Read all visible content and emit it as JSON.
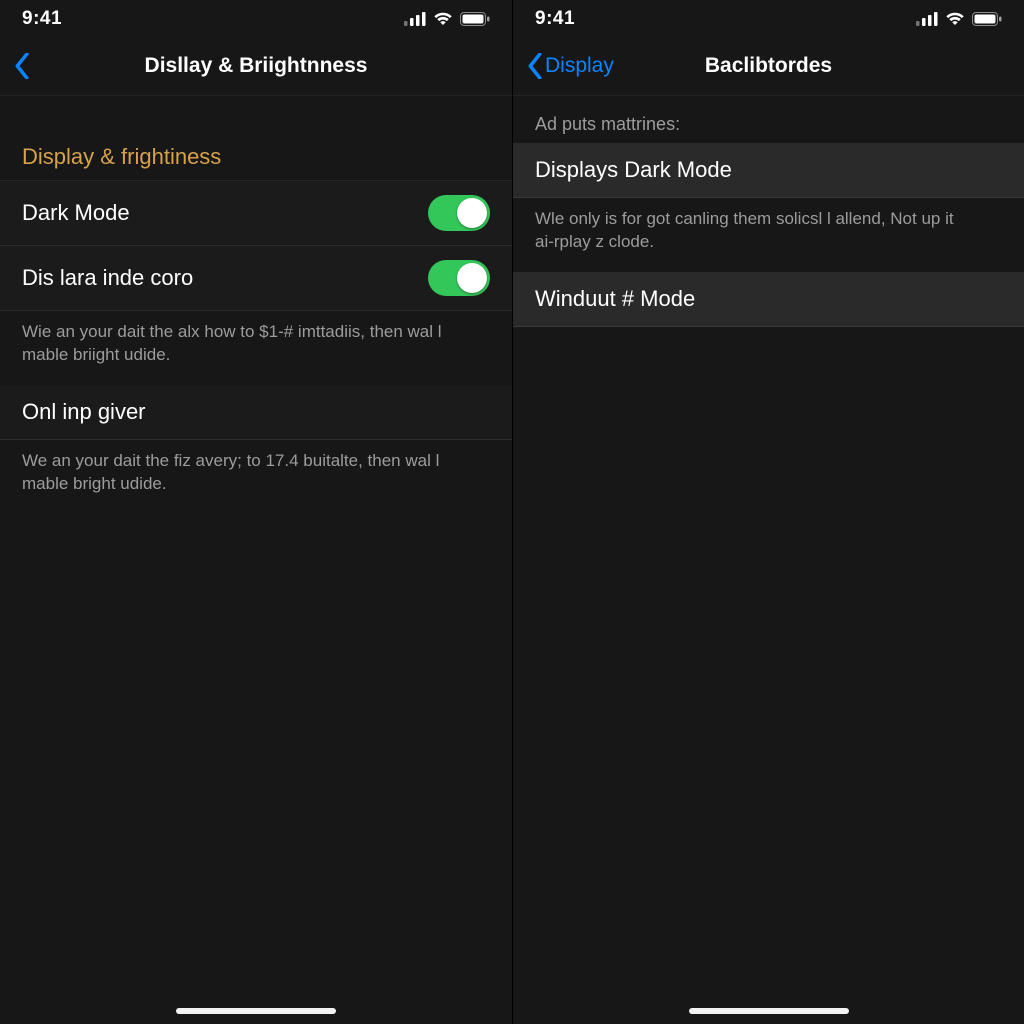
{
  "status": {
    "time": "9:41"
  },
  "left": {
    "nav_title": "Disllay & Briightnness",
    "section_heading": "Display & frightiness",
    "rows": {
      "dark_mode": {
        "label": "Dark Mode",
        "value": true
      },
      "auto_brightness": {
        "label": "Dis lara inde coro",
        "value": true
      },
      "auto_brightness_desc": "Wie an your dait the alx how to $1-# imttadiis, then wal l mable briight udide.",
      "onl_inp_giver": {
        "label": "Onl inp giver"
      },
      "onl_inp_giver_desc": "We an your dait the fiz avery; to 17.4 buitalte, then wal l mable bright udide."
    }
  },
  "right": {
    "back_label": "Display",
    "nav_title": "Baclibtordes",
    "section_caption": "Ad puts mattrines:",
    "rows": {
      "displays_dark_mode": {
        "label": "Displays Dark Mode"
      },
      "displays_dark_mode_desc": "Wle only is for got canling them solicsl l allend, Not up it ai‑rplay z clode.",
      "winduut_mode": {
        "label": "Winduut # Mode"
      }
    }
  },
  "colors": {
    "accent_blue": "#0a84ff",
    "accent_green": "#33c759",
    "accent_gold": "#d6a24a"
  }
}
